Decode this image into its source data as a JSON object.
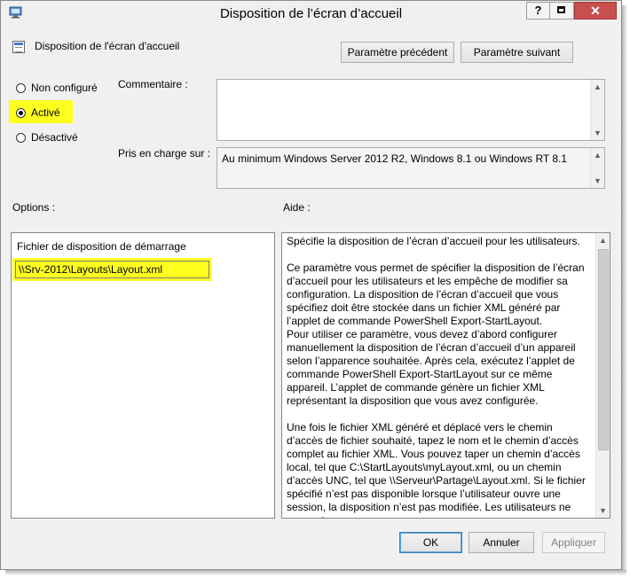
{
  "window": {
    "title": "Disposition de l’écran d’accueil",
    "help_glyph": "?",
    "close_glyph": "✕"
  },
  "header": {
    "policy_name": "Disposition de l'écran d'accueil",
    "prev_button": "Paramètre précédent",
    "next_button": "Paramètre suivant"
  },
  "state": {
    "options": [
      {
        "label": "Non configuré",
        "selected": false
      },
      {
        "label": "Activé",
        "selected": true
      },
      {
        "label": "Désactivé",
        "selected": false
      }
    ]
  },
  "fields": {
    "comment_label": "Commentaire :",
    "comment_value": "",
    "supported_label": "Pris en charge sur :",
    "supported_value": "Au minimum Windows Server 2012 R2, Windows 8.1 ou Windows RT 8.1"
  },
  "options_section": {
    "label": "Options :",
    "field_label": "Fichier de disposition de démarrage",
    "field_value": "\\\\Srv-2012\\Layouts\\Layout.xml"
  },
  "help_section": {
    "label": "Aide :",
    "paragraphs": [
      "Spécifie la disposition de l’écran d’accueil pour les utilisateurs.",
      "Ce paramètre vous permet de spécifier la disposition de l’écran d’accueil pour les utilisateurs et les empêche de modifier sa configuration. La disposition de l’écran d’accueil que vous spécifiez doit être stockée dans un fichier XML généré par l’applet de commande PowerShell Export-StartLayout.",
      "Pour utiliser ce paramètre, vous devez d’abord configurer manuellement la disposition de l’écran d’accueil d’un appareil selon l’apparence souhaitée. Après cela, exécutez l’applet de commande PowerShell Export-StartLayout sur ce même appareil. L’applet de commande génère un fichier XML représentant la disposition que vous avez configurée.",
      "Une fois le fichier XML généré et déplacé vers le chemin d’accès de fichier souhaité, tapez le nom et le chemin d’accès complet au fichier XML. Vous pouvez taper un chemin d’accès local, tel que C:\\StartLayouts\\myLayout.xml, ou un chemin d’accès UNC, tel que \\\\Serveur\\Partage\\Layout.xml. Si le fichier spécifié n’est pas disponible lorsque l’utilisateur ouvre une session, la disposition n’est pas modifiée. Les utilisateurs ne peuvent pas"
    ]
  },
  "footer": {
    "ok": "OK",
    "cancel": "Annuler",
    "apply": "Appliquer"
  },
  "colors": {
    "highlight": "#ffff1f",
    "close_button": "#c7504f",
    "window_bg": "#f0f0f0"
  }
}
